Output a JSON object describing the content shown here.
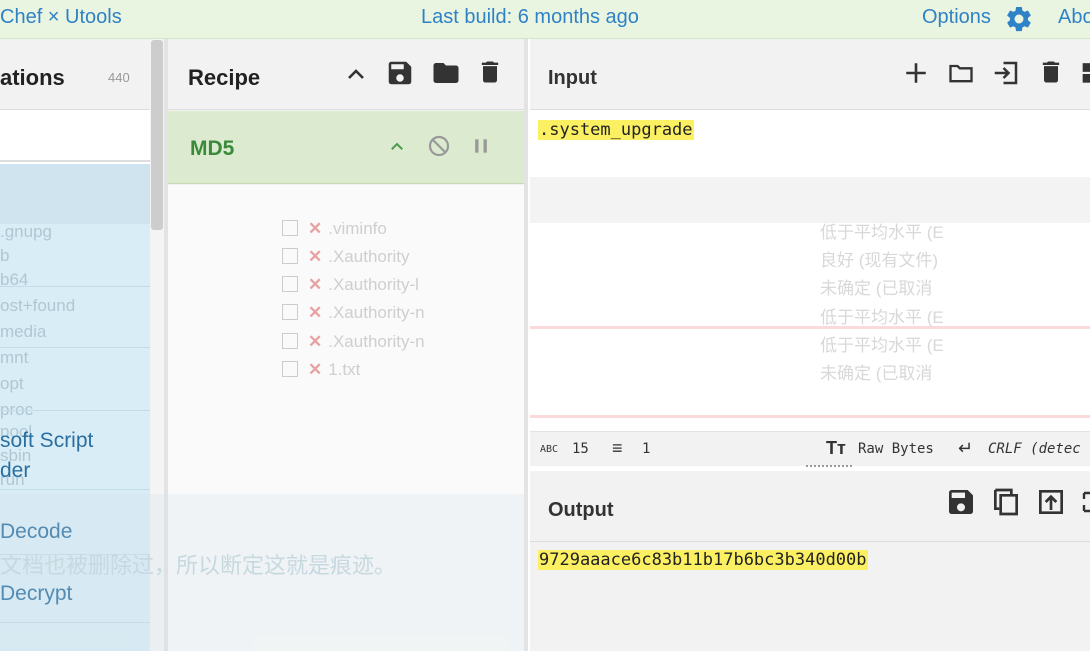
{
  "topbar": {
    "title": "Chef × Utools",
    "build": "Last build: 6 months ago",
    "options": "Options",
    "about": "Abo"
  },
  "operations": {
    "title": "ations",
    "count": "440",
    "items": [
      "soft Script",
      "der",
      "Decode",
      "Decrypt"
    ]
  },
  "recipe": {
    "title": "Recipe",
    "op_name": "MD5"
  },
  "input": {
    "title": "Input",
    "value": ".system_upgrade",
    "stats": {
      "length": "15",
      "lines": "1",
      "encoding": "Raw Bytes",
      "eol": "CRLF (detec"
    }
  },
  "output": {
    "title": "Output",
    "value": "9729aaace6c83b11b17b6bc3b340d00b"
  },
  "background_ghost": {
    "files": [
      ".gnupg",
      "b",
      "b64",
      "ost+found",
      "media",
      "mnt",
      "opt",
      "proc",
      "pool",
      "sbin",
      "run"
    ],
    "list": [
      ".viminfo",
      ".Xauthority",
      ".Xauthority-l",
      ".Xauthority-n",
      ".Xauthority-n",
      "1.txt"
    ],
    "status": [
      "低于平均水平 (E",
      "良好 (现有文件)",
      "未确定 (已取消",
      "低于平均水平 (E",
      "低于平均水平 (E",
      "未确定 (已取消"
    ],
    "caption": "文档也被删除过，所以断定这就是痕迹。"
  },
  "colors": {
    "accent": "#2f82c6",
    "recipe_green": "#dcebd0",
    "highlight": "#fbf061"
  }
}
